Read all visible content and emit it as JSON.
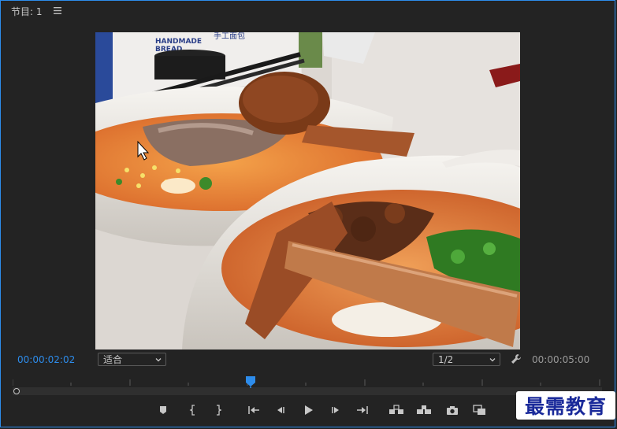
{
  "panel": {
    "title": "节目: 1",
    "menu_icon": "hamburger-menu-icon"
  },
  "viewer": {
    "content": "video-frame-noodle-bowls",
    "package_text_line1": "HANDMADE",
    "package_text_line2": "BREAD",
    "package_text_cn": "手工面包"
  },
  "transport": {
    "current_timecode": "00:00:02:02",
    "duration_timecode": "00:00:05:00",
    "zoom_select": "适合",
    "resolution_select": "1/2",
    "playhead_position_fraction": 0.404
  },
  "buttons": [
    {
      "name": "add-marker-button",
      "icon": "marker-icon"
    },
    {
      "name": "mark-in-button",
      "icon": "mark-in-icon"
    },
    {
      "name": "mark-out-button",
      "icon": "mark-out-icon"
    },
    {
      "name": "go-to-in-button",
      "icon": "go-to-in-icon"
    },
    {
      "name": "step-back-button",
      "icon": "step-back-icon"
    },
    {
      "name": "play-button",
      "icon": "play-icon"
    },
    {
      "name": "step-forward-button",
      "icon": "step-forward-icon"
    },
    {
      "name": "go-to-out-button",
      "icon": "go-to-out-icon"
    },
    {
      "name": "lift-button",
      "icon": "lift-icon"
    },
    {
      "name": "extract-button",
      "icon": "extract-icon"
    },
    {
      "name": "export-frame-button",
      "icon": "camera-icon"
    },
    {
      "name": "comparison-view-button",
      "icon": "comparison-view-icon"
    }
  ],
  "colors": {
    "accent": "#2d8ceb",
    "background": "#232323",
    "watermark_text": "#1a2a9a"
  },
  "watermark": {
    "text": "最需教育"
  }
}
